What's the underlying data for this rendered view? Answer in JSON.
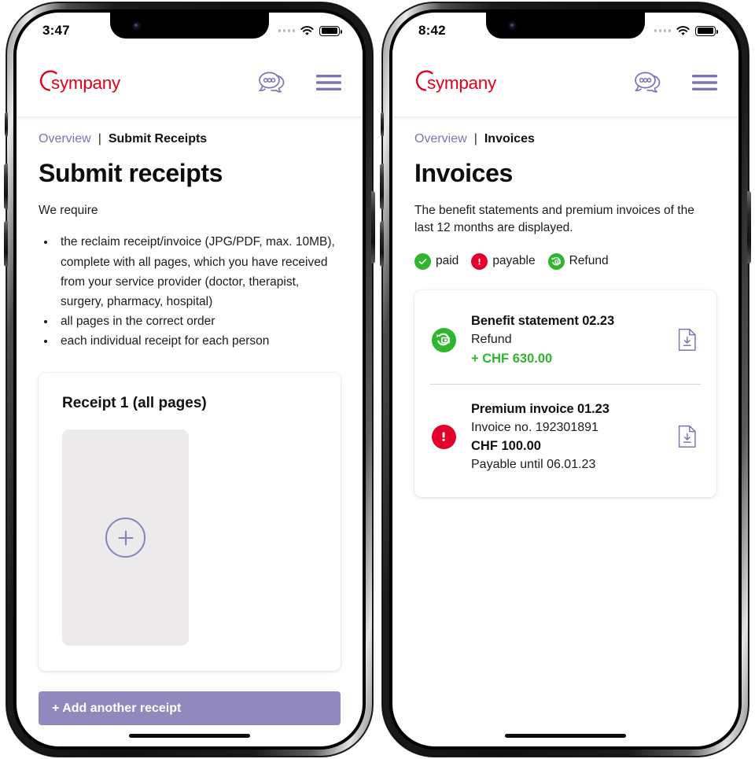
{
  "brand": {
    "logo_text": "sympany",
    "logo_color": "#e2001a",
    "accent_purple": "#7d74b4",
    "button_purple": "#9189be",
    "green": "#2eb62c",
    "red": "#e4002b",
    "divider_tan": "#e3d2bb"
  },
  "phones": [
    {
      "id": "submit-receipts",
      "status_bar": {
        "time": "3:47",
        "signal_icon": "signal-dots-icon",
        "wifi_icon": "wifi-icon",
        "battery_icon": "battery-full-icon"
      },
      "header": {
        "logo": "sympany",
        "chat_icon": "chat-bubbles-icon",
        "menu_icon": "hamburger-menu-icon"
      },
      "breadcrumb": {
        "parent": "Overview",
        "separator": "|",
        "current": "Submit Receipts"
      },
      "title": "Submit receipts",
      "intro": "We require",
      "requirements": [
        "the reclaim receipt/invoice (JPG/PDF, max. 10MB), complete with all pages, which you have received from your service provider (doctor, therapist, surgery, pharmacy, hospital)",
        "all pages in the correct order",
        "each individual receipt for each person"
      ],
      "receipt_card": {
        "title": "Receipt 1 (all pages)",
        "upload_icon": "plus-circle-icon"
      },
      "add_button": "+ Add another receipt"
    },
    {
      "id": "invoices",
      "status_bar": {
        "time": "8:42",
        "signal_icon": "signal-dots-icon",
        "wifi_icon": "wifi-icon",
        "battery_icon": "battery-full-icon"
      },
      "header": {
        "logo": "sympany",
        "chat_icon": "chat-bubbles-icon",
        "menu_icon": "hamburger-menu-icon"
      },
      "breadcrumb": {
        "parent": "Overview",
        "separator": "|",
        "current": "Invoices"
      },
      "title": "Invoices",
      "intro": "The benefit statements and premium invoices of the last 12 months are displayed.",
      "legend": [
        {
          "icon": "check-circle-icon",
          "label": "paid",
          "color": "#2eb62c"
        },
        {
          "icon": "exclamation-circle-icon",
          "label": "payable",
          "color": "#e4002b"
        },
        {
          "icon": "refund-circle-icon",
          "label": "Refund",
          "color": "#2eb62c"
        }
      ],
      "invoices": [
        {
          "status_icon": "refund-circle-icon",
          "status": "refund",
          "title": "Benefit statement 02.23",
          "subtitle": "Refund",
          "amount": "+ CHF 630.00",
          "amount_positive": true,
          "download_icon": "document-download-icon"
        },
        {
          "status_icon": "exclamation-circle-icon",
          "status": "payable",
          "title": "Premium invoice 01.23",
          "subtitle": "Invoice no. 192301891",
          "amount": "CHF 100.00",
          "amount_positive": false,
          "due": "Payable until 06.01.23",
          "download_icon": "document-download-icon"
        }
      ]
    }
  ]
}
